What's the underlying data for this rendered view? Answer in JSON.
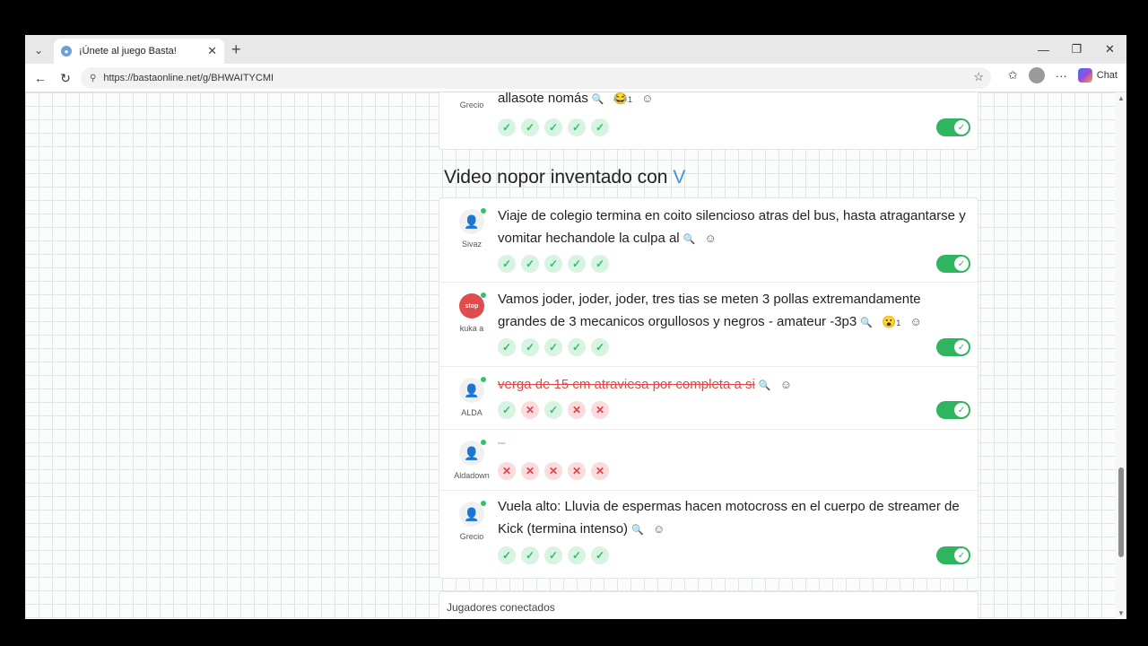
{
  "browser": {
    "tab_title": "¡Únete al juego Basta!",
    "url": "https://bastaonline.net/g/BHWAITYCMI",
    "chat_label": "Chat"
  },
  "top_entry": {
    "player": "Grecio",
    "answer": "allasote nomás",
    "reaction_emoji": "😂",
    "reaction_count": "1",
    "votes": [
      "ok",
      "ok",
      "ok",
      "ok",
      "ok"
    ],
    "validated": true
  },
  "section": {
    "title": "Video nopor inventado con",
    "letter": "V"
  },
  "entries": [
    {
      "player": "Sivaz",
      "answer": "Viaje de colegio termina en coito silencioso atras del bus, hasta atragantarse y vomitar hechandole la culpa al",
      "votes": [
        "ok",
        "ok",
        "ok",
        "ok",
        "ok"
      ],
      "validated": true
    },
    {
      "player": "kuka a",
      "avatar_text": "stop",
      "answer": "Vamos joder, joder, joder, tres tias se meten 3 pollas extremandamente grandes de 3 mecanicos orgullosos y negros - amateur -3p3",
      "reaction_emoji": "😮",
      "reaction_count": "1",
      "votes": [
        "ok",
        "ok",
        "ok",
        "ok",
        "ok"
      ],
      "validated": true
    },
    {
      "player": "ALDA",
      "answer": "verga de 15 cm atraviesa por completa a si",
      "votes": [
        "ok",
        "no",
        "ok",
        "no",
        "no"
      ],
      "validated": true
    },
    {
      "player": "Aldadown",
      "answer": "",
      "votes": [
        "no",
        "no",
        "no",
        "no",
        "no"
      ],
      "validated": false
    },
    {
      "player": "Grecio",
      "answer": "Vuela alto: Lluvia de espermas hacen motocross en el cuerpo de streamer de Kick (termina intenso)",
      "votes": [
        "ok",
        "ok",
        "ok",
        "ok",
        "ok"
      ],
      "validated": true
    }
  ],
  "connected_players_label": "Jugadores conectados",
  "icons": {
    "search": "search-icon",
    "reaction": "add-reaction-icon",
    "check": "✓",
    "cross": "✕"
  }
}
